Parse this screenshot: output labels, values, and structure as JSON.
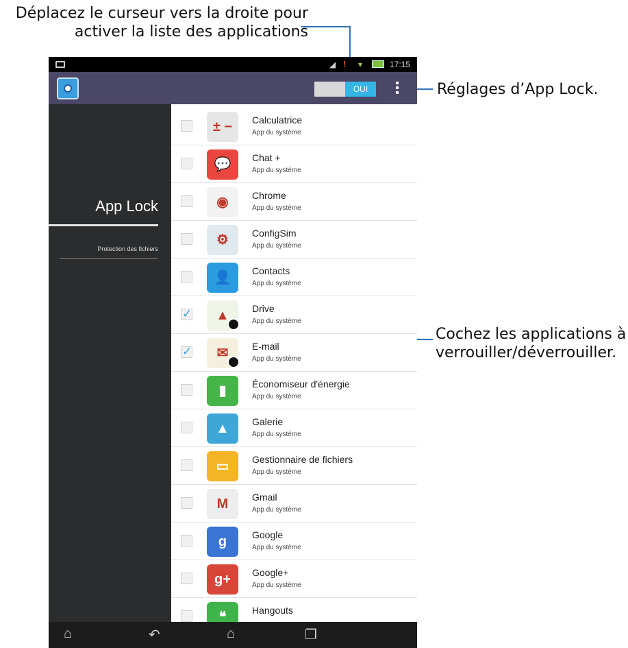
{
  "annotations": {
    "top_line1": "Déplacez le curseur vers la droite pour",
    "top_line2": "activer la liste des applications",
    "right1": "Réglages d’App Lock.",
    "right2_line1": "Cochez les applications à",
    "right2_line2": "verrouiller/déverrouiller."
  },
  "statusbar": {
    "time": "17:15"
  },
  "actionbar": {
    "toggle_label": "OUI"
  },
  "sidebar": {
    "title": "App Lock",
    "subitem": "Protection des fichiers"
  },
  "apps": [
    {
      "name": "Calculatrice",
      "sub": "App du système",
      "checked": false,
      "icon": "calculator-icon",
      "color": "#e6e6e6",
      "glyph": "± −"
    },
    {
      "name": "Chat +",
      "sub": "App du système",
      "checked": false,
      "icon": "chat-icon",
      "color": "#e8463f",
      "glyph": "💬"
    },
    {
      "name": "Chrome",
      "sub": "App du système",
      "checked": false,
      "icon": "chrome-icon",
      "color": "#f2f2f2",
      "glyph": "◉"
    },
    {
      "name": "ConfigSim",
      "sub": "App du système",
      "checked": false,
      "icon": "configsim-icon",
      "color": "#dfe9ee",
      "glyph": "⚙"
    },
    {
      "name": "Contacts",
      "sub": "App du système",
      "checked": false,
      "icon": "contacts-icon",
      "color": "#2b9be0",
      "glyph": "👤"
    },
    {
      "name": "Drive",
      "sub": "App du système",
      "checked": true,
      "icon": "drive-icon",
      "color": "#eef4e6",
      "glyph": "▲"
    },
    {
      "name": "E-mail",
      "sub": "App du système",
      "checked": true,
      "icon": "email-icon",
      "color": "#f5f0de",
      "glyph": "✉"
    },
    {
      "name": "Économiseur d'énergie",
      "sub": "App du système",
      "checked": false,
      "icon": "battery-icon",
      "color": "#45b54a",
      "glyph": "▮"
    },
    {
      "name": "Galerie",
      "sub": "App du système",
      "checked": false,
      "icon": "gallery-icon",
      "color": "#3ea7d8",
      "glyph": "▲"
    },
    {
      "name": "Gestionnaire de fichiers",
      "sub": "App du système",
      "checked": false,
      "icon": "folder-icon",
      "color": "#f6b427",
      "glyph": "▭"
    },
    {
      "name": "Gmail",
      "sub": "App du système",
      "checked": false,
      "icon": "gmail-icon",
      "color": "#eeeeee",
      "glyph": "M"
    },
    {
      "name": "Google",
      "sub": "App du système",
      "checked": false,
      "icon": "google-icon",
      "color": "#3a75d6",
      "glyph": "g"
    },
    {
      "name": "Google+",
      "sub": "App du système",
      "checked": false,
      "icon": "googleplus-icon",
      "color": "#d8463a",
      "glyph": "g+"
    },
    {
      "name": "Hangouts",
      "sub": "",
      "checked": false,
      "icon": "hangouts-icon",
      "color": "#3fb44b",
      "glyph": "❝"
    }
  ],
  "colors": {
    "accent": "#2f6fb5",
    "actionbar": "#4b4766",
    "toggle_on": "#33b5e5"
  }
}
